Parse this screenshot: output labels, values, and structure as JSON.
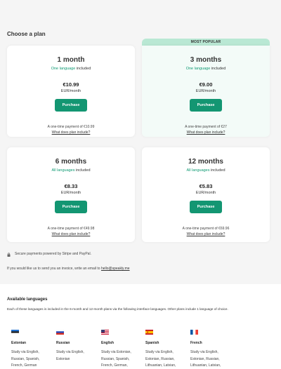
{
  "page": {
    "title": "Choose a plan"
  },
  "popular_badge": "MOST POPULAR",
  "plans": [
    {
      "name": "1 month",
      "includes_highlight": "One language",
      "includes_suffix": " included",
      "price": "€10.99",
      "unit": "EUR/month",
      "button": "Purchase",
      "payment": "A one-time payment of €10.99",
      "link": "What does plan include?"
    },
    {
      "name": "3 months",
      "includes_highlight": "One language",
      "includes_suffix": " included",
      "price": "€9.00",
      "unit": "EUR/month",
      "button": "Purchase",
      "payment": "A one-time payment of €27",
      "link": "What does plan include?"
    },
    {
      "name": "6 months",
      "includes_highlight": "All languages",
      "includes_suffix": " included",
      "price": "€8.33",
      "unit": "EUR/month",
      "button": "Purchase",
      "payment": "A one-time payment of €49.98",
      "link": "What does plan include?"
    },
    {
      "name": "12 months",
      "includes_highlight": "All languages",
      "includes_suffix": " included",
      "price": "€5.83",
      "unit": "EUR/month",
      "button": "Purchase",
      "payment": "A one-time payment of €69.96",
      "link": "What does plan include?"
    }
  ],
  "secure_text": "Secure payments powered by Stripe and PayPal.",
  "invoice": {
    "text": "If you would like us to send you an invoice, write an email to ",
    "email": "hello@speakly.me"
  },
  "languages_section": {
    "title": "Available languages",
    "description": "Each of these languages is included in the 6-month and 12-month plans via the following interface languages. Other plans include 1 language of choice.",
    "languages": [
      {
        "name": "Estonian",
        "flag": "estonia-flag",
        "lines": [
          "Study via English,",
          "Russian, Spanish,",
          "French, German"
        ]
      },
      {
        "name": "Russian",
        "flag": "russia-flag",
        "lines": [
          "Study via English,",
          "Estonian"
        ]
      },
      {
        "name": "English",
        "flag": "usa-flag",
        "lines": [
          "Study via Estonian,",
          "Russian, Spanish,",
          "French, German,"
        ]
      },
      {
        "name": "Spanish",
        "flag": "spain-flag",
        "lines": [
          "Study via English,",
          "Estonian, Russian,",
          "Lithuanian, Latvian,"
        ]
      },
      {
        "name": "French",
        "flag": "france-flag",
        "lines": [
          "Study via English,",
          "Estonian, Russian,",
          "Lithuanian, Latvian,"
        ]
      }
    ]
  },
  "colors": {
    "accent": "#139672",
    "highlight": "#0f9a73",
    "badge": "#b9e8d4"
  }
}
